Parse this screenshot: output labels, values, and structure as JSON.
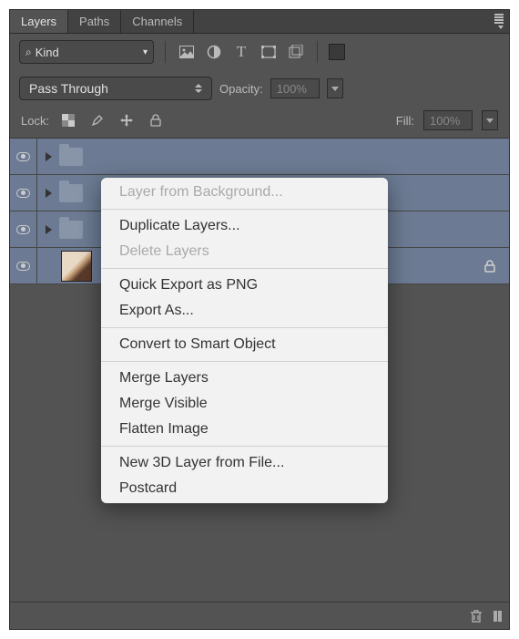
{
  "tabs": {
    "layers": "Layers",
    "paths": "Paths",
    "channels": "Channels"
  },
  "filter": {
    "kind": "Kind"
  },
  "blend": {
    "mode": "Pass Through"
  },
  "opacity": {
    "label": "Opacity:",
    "value": "100%"
  },
  "lock": {
    "label": "Lock:"
  },
  "fill": {
    "label": "Fill:",
    "value": "100%"
  },
  "layers_list": [
    {
      "type": "group"
    },
    {
      "type": "group"
    },
    {
      "type": "group"
    },
    {
      "type": "image",
      "locked": true
    }
  ],
  "context_menu": {
    "items": [
      {
        "label": "Layer from Background...",
        "disabled": true
      },
      {
        "sep": true
      },
      {
        "label": "Duplicate Layers..."
      },
      {
        "label": "Delete Layers",
        "disabled": true
      },
      {
        "sep": true
      },
      {
        "label": "Quick Export as PNG"
      },
      {
        "label": "Export As..."
      },
      {
        "sep": true
      },
      {
        "label": "Convert to Smart Object"
      },
      {
        "sep": true
      },
      {
        "label": "Merge Layers"
      },
      {
        "label": "Merge Visible"
      },
      {
        "label": "Flatten Image"
      },
      {
        "sep": true
      },
      {
        "label": "New 3D Layer from File..."
      },
      {
        "label": "Postcard"
      }
    ]
  }
}
